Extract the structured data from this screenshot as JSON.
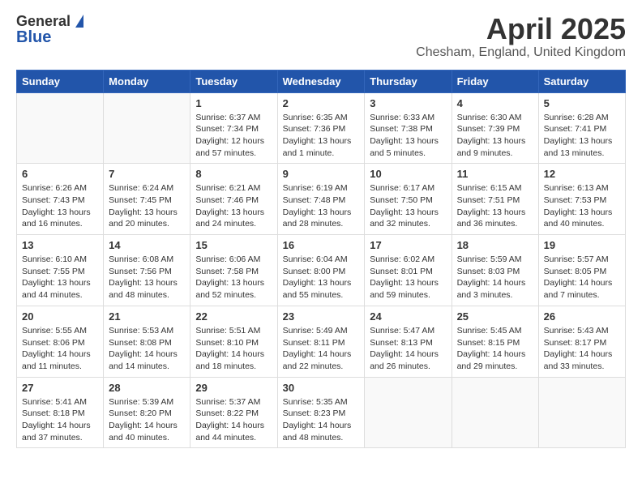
{
  "header": {
    "logo_general": "General",
    "logo_blue": "Blue",
    "month": "April 2025",
    "location": "Chesham, England, United Kingdom"
  },
  "weekdays": [
    "Sunday",
    "Monday",
    "Tuesday",
    "Wednesday",
    "Thursday",
    "Friday",
    "Saturday"
  ],
  "weeks": [
    [
      {
        "day": "",
        "text": ""
      },
      {
        "day": "",
        "text": ""
      },
      {
        "day": "1",
        "text": "Sunrise: 6:37 AM\nSunset: 7:34 PM\nDaylight: 12 hours and 57 minutes."
      },
      {
        "day": "2",
        "text": "Sunrise: 6:35 AM\nSunset: 7:36 PM\nDaylight: 13 hours and 1 minute."
      },
      {
        "day": "3",
        "text": "Sunrise: 6:33 AM\nSunset: 7:38 PM\nDaylight: 13 hours and 5 minutes."
      },
      {
        "day": "4",
        "text": "Sunrise: 6:30 AM\nSunset: 7:39 PM\nDaylight: 13 hours and 9 minutes."
      },
      {
        "day": "5",
        "text": "Sunrise: 6:28 AM\nSunset: 7:41 PM\nDaylight: 13 hours and 13 minutes."
      }
    ],
    [
      {
        "day": "6",
        "text": "Sunrise: 6:26 AM\nSunset: 7:43 PM\nDaylight: 13 hours and 16 minutes."
      },
      {
        "day": "7",
        "text": "Sunrise: 6:24 AM\nSunset: 7:45 PM\nDaylight: 13 hours and 20 minutes."
      },
      {
        "day": "8",
        "text": "Sunrise: 6:21 AM\nSunset: 7:46 PM\nDaylight: 13 hours and 24 minutes."
      },
      {
        "day": "9",
        "text": "Sunrise: 6:19 AM\nSunset: 7:48 PM\nDaylight: 13 hours and 28 minutes."
      },
      {
        "day": "10",
        "text": "Sunrise: 6:17 AM\nSunset: 7:50 PM\nDaylight: 13 hours and 32 minutes."
      },
      {
        "day": "11",
        "text": "Sunrise: 6:15 AM\nSunset: 7:51 PM\nDaylight: 13 hours and 36 minutes."
      },
      {
        "day": "12",
        "text": "Sunrise: 6:13 AM\nSunset: 7:53 PM\nDaylight: 13 hours and 40 minutes."
      }
    ],
    [
      {
        "day": "13",
        "text": "Sunrise: 6:10 AM\nSunset: 7:55 PM\nDaylight: 13 hours and 44 minutes."
      },
      {
        "day": "14",
        "text": "Sunrise: 6:08 AM\nSunset: 7:56 PM\nDaylight: 13 hours and 48 minutes."
      },
      {
        "day": "15",
        "text": "Sunrise: 6:06 AM\nSunset: 7:58 PM\nDaylight: 13 hours and 52 minutes."
      },
      {
        "day": "16",
        "text": "Sunrise: 6:04 AM\nSunset: 8:00 PM\nDaylight: 13 hours and 55 minutes."
      },
      {
        "day": "17",
        "text": "Sunrise: 6:02 AM\nSunset: 8:01 PM\nDaylight: 13 hours and 59 minutes."
      },
      {
        "day": "18",
        "text": "Sunrise: 5:59 AM\nSunset: 8:03 PM\nDaylight: 14 hours and 3 minutes."
      },
      {
        "day": "19",
        "text": "Sunrise: 5:57 AM\nSunset: 8:05 PM\nDaylight: 14 hours and 7 minutes."
      }
    ],
    [
      {
        "day": "20",
        "text": "Sunrise: 5:55 AM\nSunset: 8:06 PM\nDaylight: 14 hours and 11 minutes."
      },
      {
        "day": "21",
        "text": "Sunrise: 5:53 AM\nSunset: 8:08 PM\nDaylight: 14 hours and 14 minutes."
      },
      {
        "day": "22",
        "text": "Sunrise: 5:51 AM\nSunset: 8:10 PM\nDaylight: 14 hours and 18 minutes."
      },
      {
        "day": "23",
        "text": "Sunrise: 5:49 AM\nSunset: 8:11 PM\nDaylight: 14 hours and 22 minutes."
      },
      {
        "day": "24",
        "text": "Sunrise: 5:47 AM\nSunset: 8:13 PM\nDaylight: 14 hours and 26 minutes."
      },
      {
        "day": "25",
        "text": "Sunrise: 5:45 AM\nSunset: 8:15 PM\nDaylight: 14 hours and 29 minutes."
      },
      {
        "day": "26",
        "text": "Sunrise: 5:43 AM\nSunset: 8:17 PM\nDaylight: 14 hours and 33 minutes."
      }
    ],
    [
      {
        "day": "27",
        "text": "Sunrise: 5:41 AM\nSunset: 8:18 PM\nDaylight: 14 hours and 37 minutes."
      },
      {
        "day": "28",
        "text": "Sunrise: 5:39 AM\nSunset: 8:20 PM\nDaylight: 14 hours and 40 minutes."
      },
      {
        "day": "29",
        "text": "Sunrise: 5:37 AM\nSunset: 8:22 PM\nDaylight: 14 hours and 44 minutes."
      },
      {
        "day": "30",
        "text": "Sunrise: 5:35 AM\nSunset: 8:23 PM\nDaylight: 14 hours and 48 minutes."
      },
      {
        "day": "",
        "text": ""
      },
      {
        "day": "",
        "text": ""
      },
      {
        "day": "",
        "text": ""
      }
    ]
  ]
}
